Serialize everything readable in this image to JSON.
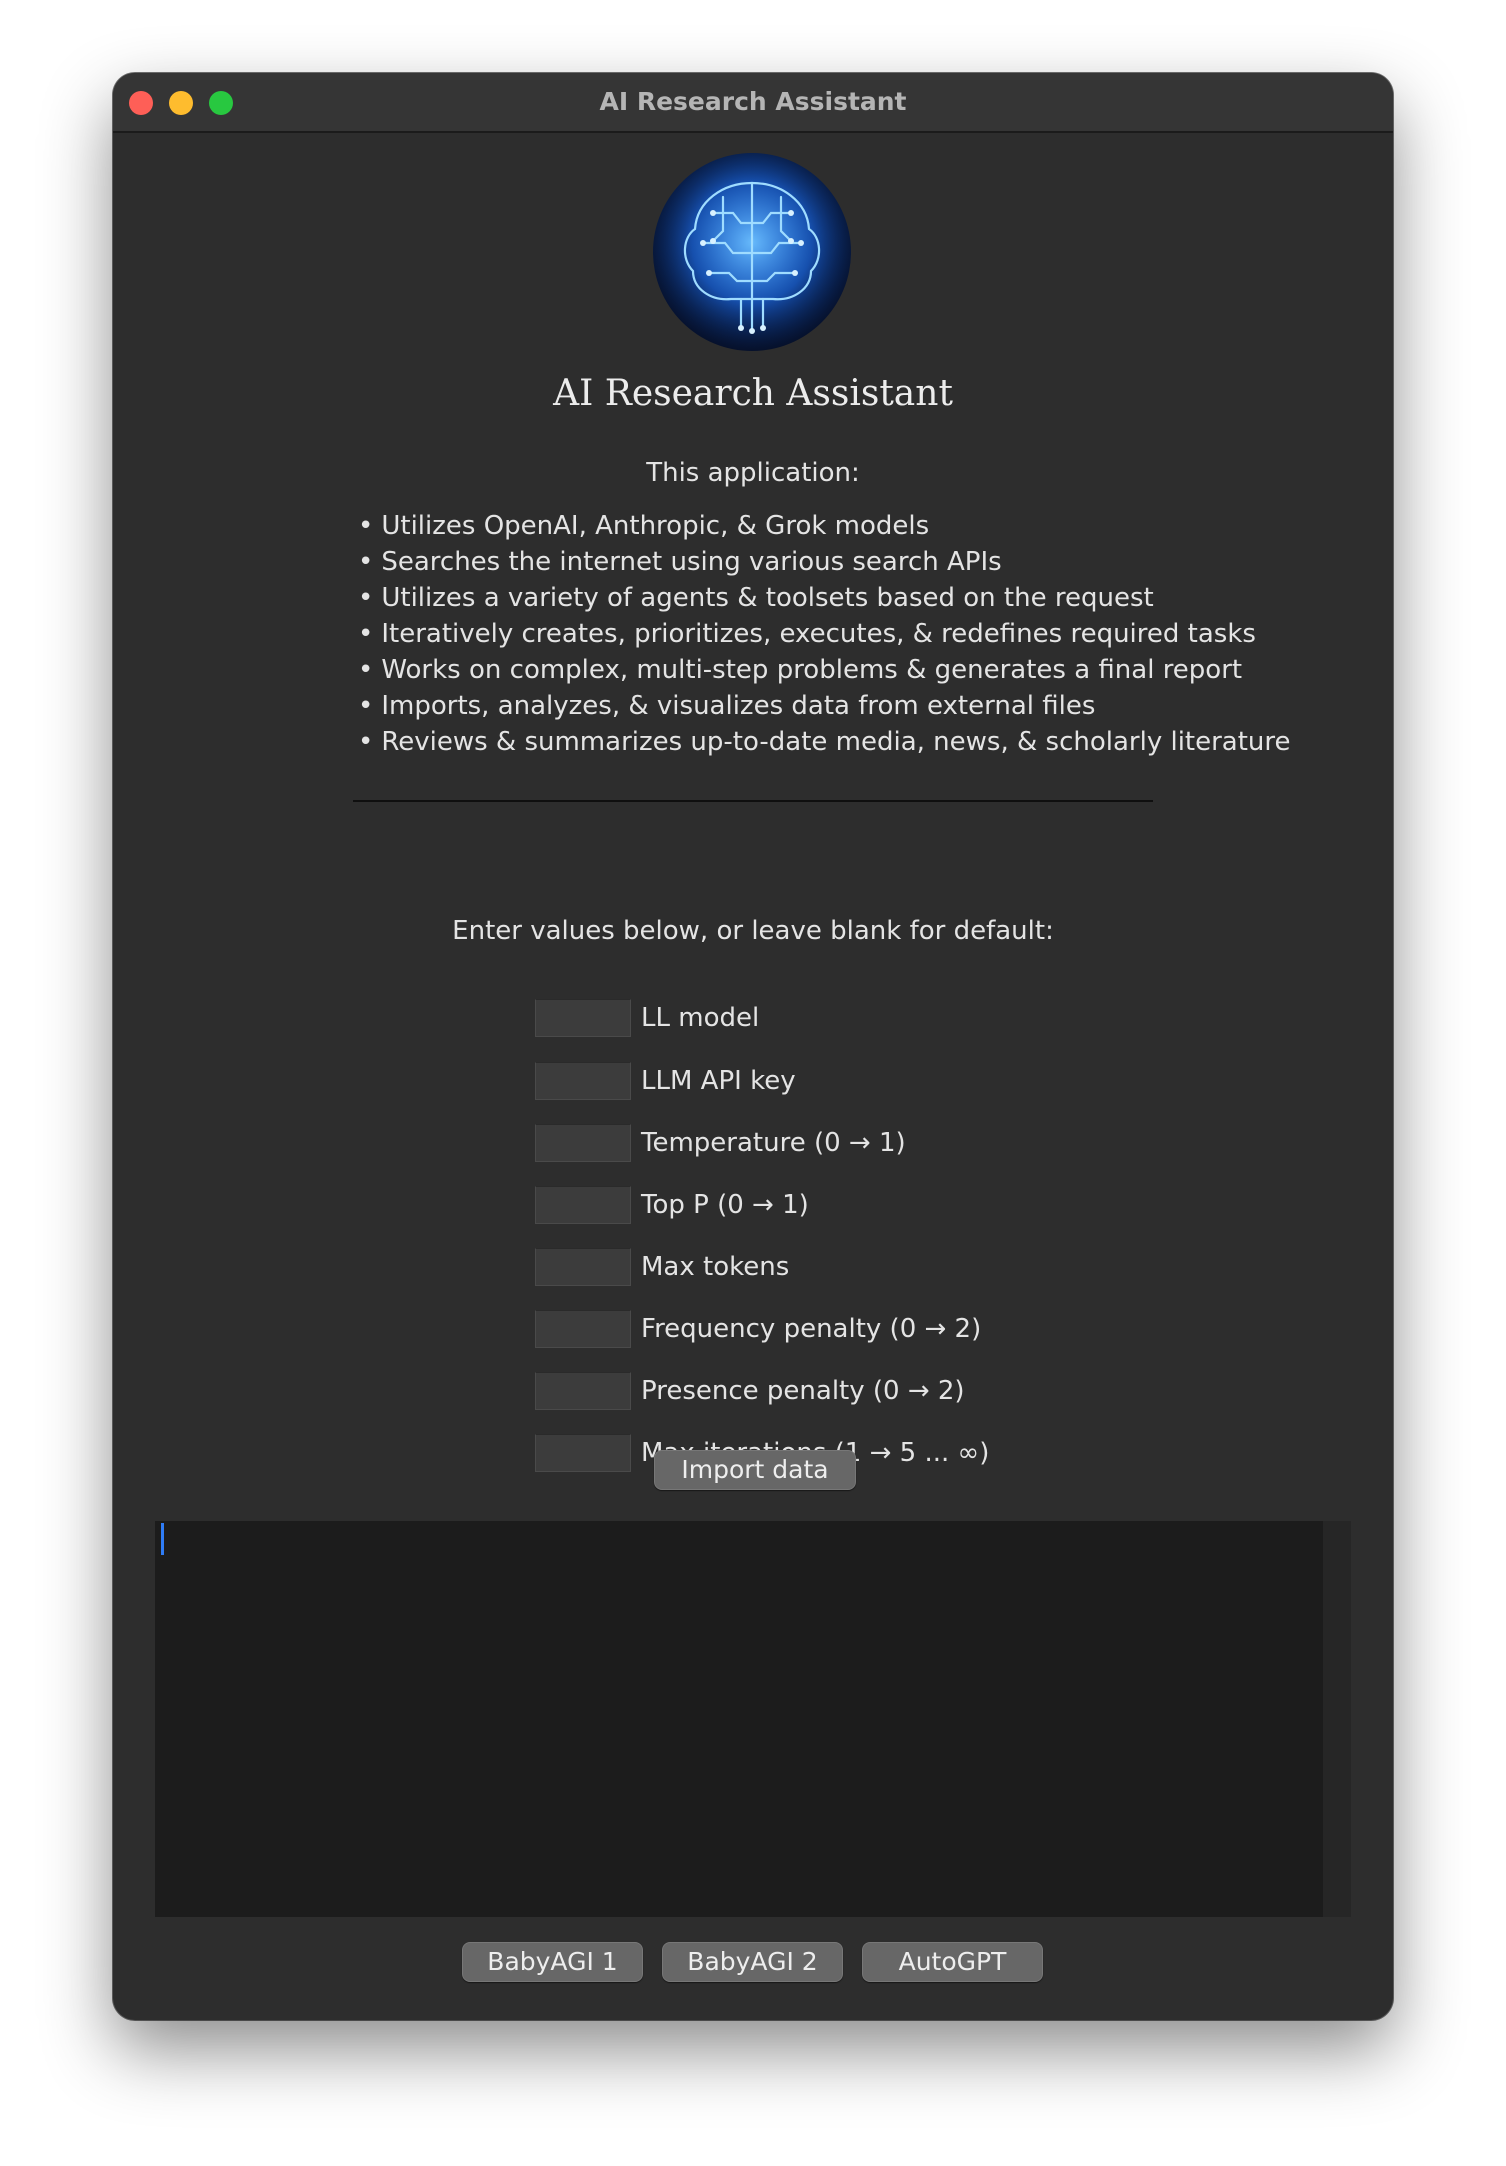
{
  "window": {
    "title": "AI Research Assistant"
  },
  "header": {
    "logo": "brain-circuit-logo",
    "app_title": "AI Research Assistant",
    "intro": "This application:"
  },
  "features": [
    "Utilizes OpenAI, Anthropic, & Grok models",
    "Searches the internet using various search APIs",
    "Utilizes a variety of agents & toolsets based on the request",
    "Iteratively creates, prioritizes, executes, & redefines required tasks",
    "Works on complex, multi-step problems & generates a final report",
    "Imports, analyzes, & visualizes data from external files",
    "Reviews & summarizes up-to-date media, news, & scholarly literature"
  ],
  "settings": {
    "instructions": "Enter values below, or leave blank for default:",
    "fields": [
      {
        "label": "LL model",
        "value": ""
      },
      {
        "label": "LLM API key",
        "value": ""
      },
      {
        "label": "Temperature (0 → 1)",
        "value": ""
      },
      {
        "label": "Top P (0 → 1)",
        "value": ""
      },
      {
        "label": "Max tokens",
        "value": ""
      },
      {
        "label": "Frequency penalty (0 → 2)",
        "value": ""
      },
      {
        "label": "Presence penalty (0 → 2)",
        "value": ""
      },
      {
        "label": "Max iterations (1 → 5 ... ∞)",
        "value": ""
      }
    ]
  },
  "actions": {
    "import_label": "Import data",
    "output_text": "",
    "agents": [
      "BabyAGI 1",
      "BabyAGI 2",
      "AutoGPT"
    ]
  },
  "colors": {
    "window_bg": "#2d2d2d",
    "output_bg": "#1c1c1c",
    "button_bg": "#676767",
    "caret": "#2f7cf6",
    "close": "#fe5f57",
    "minimize": "#febc2e",
    "maximize": "#28c840"
  }
}
